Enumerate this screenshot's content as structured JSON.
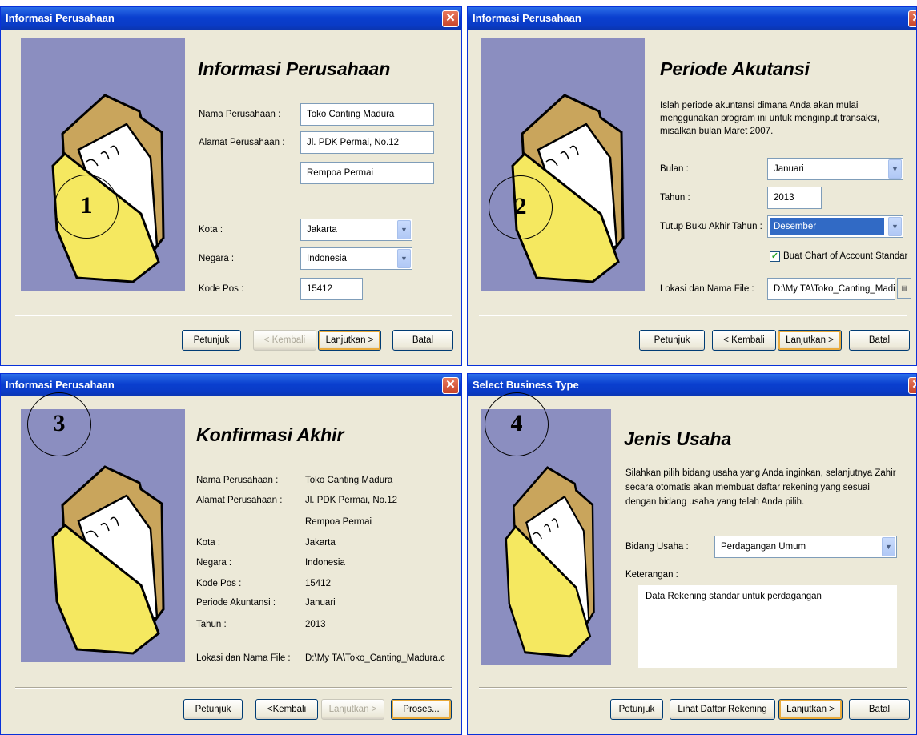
{
  "w1": {
    "title": "Informasi Perusahaan",
    "heading": "Informasi Perusahaan",
    "number": "1",
    "nama_label": "Nama Perusahaan :",
    "nama_value": "Toko Canting Madura",
    "alamat_label": "Alamat Perusahaan :",
    "alamat1": "Jl. PDK Permai, No.12",
    "alamat2": "Rempoa Permai",
    "kota_label": "Kota :",
    "kota_value": "Jakarta",
    "negara_label": "Negara :",
    "negara_value": "Indonesia",
    "kodepos_label": "Kode Pos :",
    "kodepos_value": "15412",
    "buttons": {
      "help": "Petunjuk",
      "back": "< Kembali",
      "next": "Lanjutkan >",
      "cancel": "Batal"
    }
  },
  "w2": {
    "title": "Informasi Perusahaan",
    "heading": "Periode Akutansi",
    "number": "2",
    "desc": "Islah periode akuntansi dimana Anda akan mulai menggunakan program ini untuk menginput transaksi, misalkan bulan Maret 2007.",
    "bulan_label": "Bulan :",
    "bulan_value": "Januari",
    "tahun_label": "Tahun :",
    "tahun_value": "2013",
    "tutup_label": "Tutup Buku Akhir Tahun :",
    "tutup_value": "Desember",
    "checkbox_label": "Buat Chart of Account Standar",
    "file_label": "Lokasi dan Nama File :",
    "file_value": "D:\\My TA\\Toko_Canting_Madi",
    "buttons": {
      "help": "Petunjuk",
      "back": "< Kembali",
      "next": "Lanjutkan >",
      "cancel": "Batal"
    }
  },
  "w3": {
    "title": "Informasi Perusahaan",
    "heading": "Konfirmasi Akhir",
    "number": "3",
    "rows": [
      {
        "label": "Nama Perusahaan :",
        "value": "Toko Canting Madura"
      },
      {
        "label": "Alamat Perusahaan :",
        "value": "Jl. PDK Permai, No.12"
      },
      {
        "label": "",
        "value": "Rempoa Permai"
      },
      {
        "label": "Kota :",
        "value": "Jakarta"
      },
      {
        "label": "Negara :",
        "value": "Indonesia"
      },
      {
        "label": "Kode Pos :",
        "value": "15412"
      },
      {
        "label": "Periode Akuntansi :",
        "value": "Januari"
      },
      {
        "label": "Tahun :",
        "value": "2013"
      },
      {
        "label": "Lokasi dan Nama File :",
        "value": "D:\\My TA\\Toko_Canting_Madura.c"
      }
    ],
    "buttons": {
      "help": "Petunjuk",
      "back": "<Kembali",
      "next": "Lanjutkan >",
      "process": "Proses..."
    }
  },
  "w4": {
    "title": "Select Business Type",
    "heading": "Jenis Usaha",
    "number": "4",
    "desc": "Silahkan pilih bidang usaha yang Anda inginkan, selanjutnya Zahir secara otomatis akan membuat daftar rekening yang sesuai dengan bidang usaha yang telah Anda pilih.",
    "bidang_label": "Bidang Usaha :",
    "bidang_value": "Perdagangan Umum",
    "ket_label": "Keterangan :",
    "ket_value": "Data Rekening standar untuk perdagangan",
    "buttons": {
      "help": "Petunjuk",
      "list": "Lihat Daftar Rekening",
      "next": "Lanjutkan >",
      "cancel": "Batal"
    }
  },
  "icons": {
    "close": "close-icon",
    "dropdown": "chevron-down-icon",
    "folder": "folder-icon",
    "check": "check-icon",
    "browse": "browse-icon"
  },
  "colors": {
    "titlebar": "#0a3fcf",
    "panel": "#ece9d8",
    "illustration": "#8b8ec0",
    "folder": "#f5e860",
    "folder_back": "#c9a55c",
    "selection": "#316ac5"
  }
}
